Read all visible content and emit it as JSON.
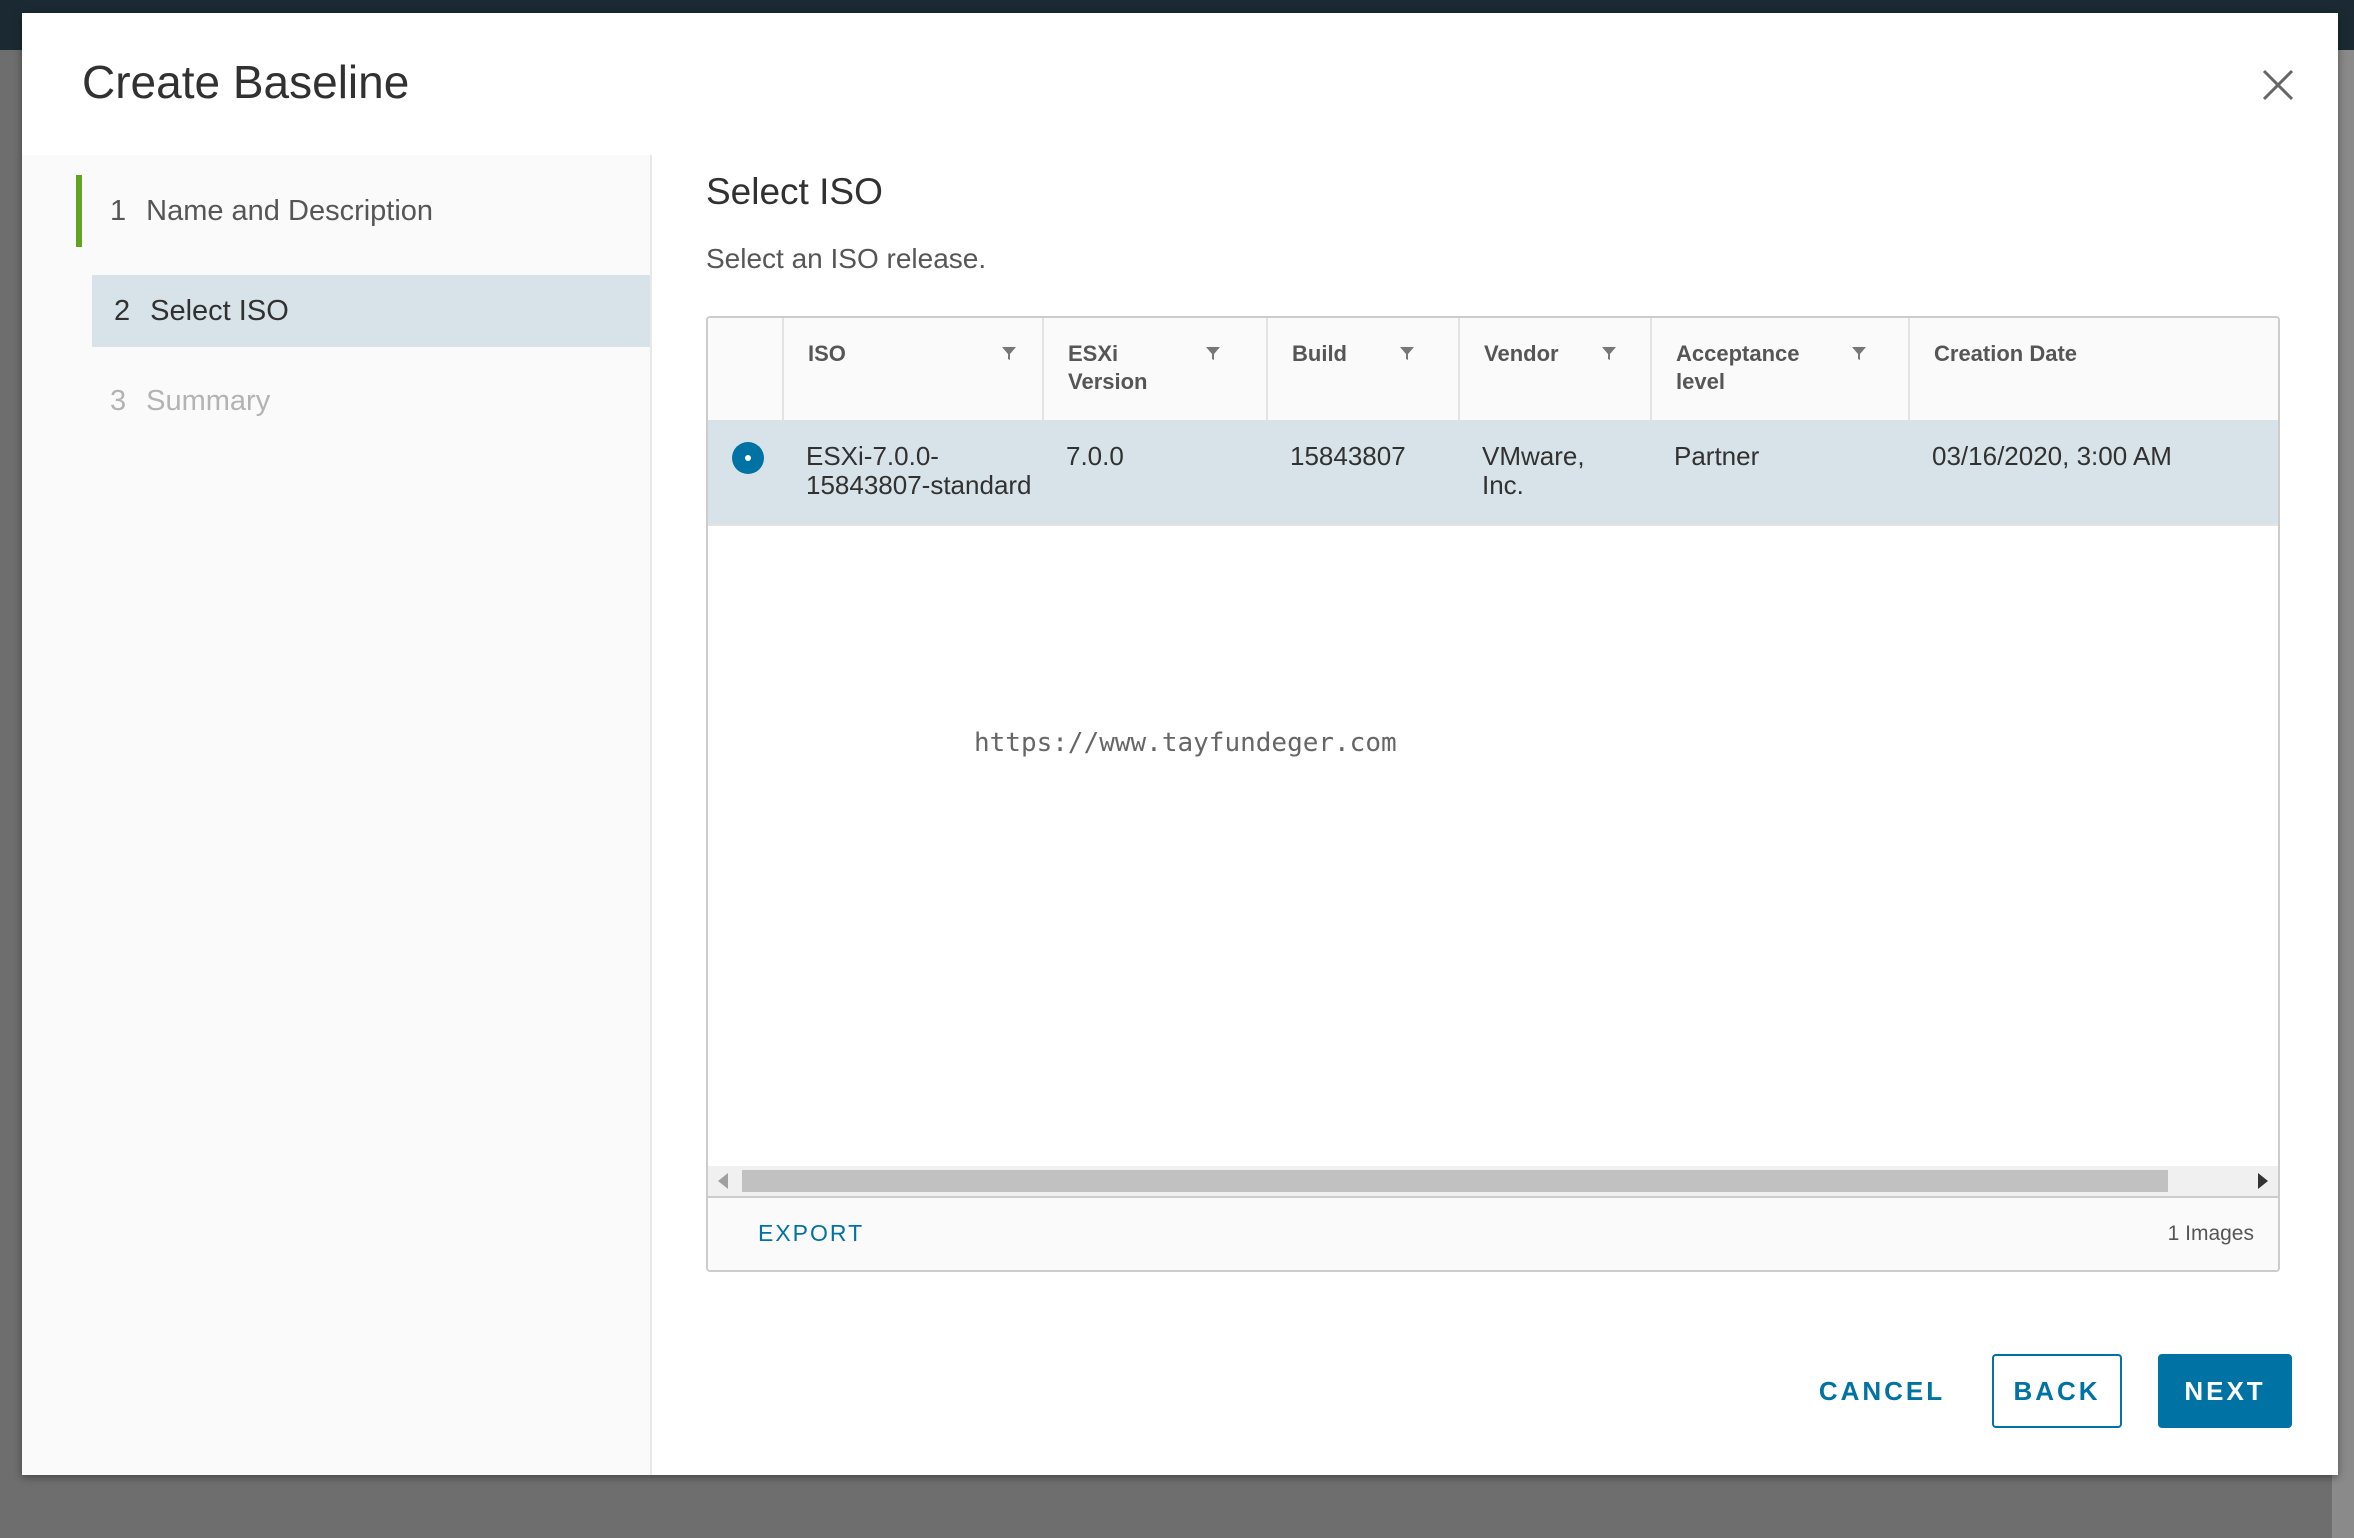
{
  "dialog": {
    "title": "Create Baseline",
    "close_icon": "close-icon"
  },
  "steps": [
    {
      "num": "1",
      "label": "Name and Description",
      "state": "completed"
    },
    {
      "num": "2",
      "label": "Select ISO",
      "state": "active"
    },
    {
      "num": "3",
      "label": "Summary",
      "state": "disabled"
    }
  ],
  "main": {
    "title": "Select ISO",
    "description": "Select an ISO release."
  },
  "grid": {
    "columns": [
      {
        "label": "ISO",
        "filter": true
      },
      {
        "label": "ESXi Version",
        "filter": true
      },
      {
        "label": "Build",
        "filter": true
      },
      {
        "label": "Vendor",
        "filter": true
      },
      {
        "label": "Acceptance level",
        "filter": true
      },
      {
        "label": "Creation Date",
        "filter": false
      }
    ],
    "rows": [
      {
        "selected": true,
        "iso": "ESXi-7.0.0-15843807-standard",
        "version": "7.0.0",
        "build": "15843807",
        "vendor": "VMware, Inc.",
        "acceptance": "Partner",
        "creation_date": "03/16/2020, 3:00 AM"
      }
    ],
    "watermark": "https://www.tayfundeger.com",
    "export_label": "EXPORT",
    "count_label": "1 Images"
  },
  "footer": {
    "cancel": "CANCEL",
    "back": "BACK",
    "next": "NEXT"
  },
  "colors": {
    "accent": "#0072a3",
    "completed_step": "#62a420",
    "selected_row": "#d8e3e9"
  }
}
